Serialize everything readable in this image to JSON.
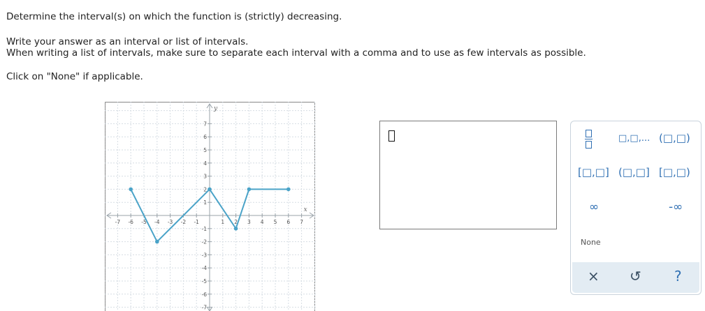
{
  "question": {
    "line1": "Determine the interval(s) on which the function is (strictly) decreasing.",
    "line2": "Write your answer as an interval or list of intervals.",
    "line3": "When writing a list of intervals, make sure to separate each interval with a comma and to use as few intervals as possible.",
    "line4": "Click on \"None\" if applicable."
  },
  "graph": {
    "xlabel": "x",
    "ylabel": "y",
    "xlim": [
      -7,
      7
    ],
    "ylim": [
      -7,
      7
    ],
    "x_ticks": [
      "-7",
      "-6",
      "-5",
      "-4",
      "-3",
      "-2",
      "-1",
      "1",
      "2",
      "3",
      "4",
      "5",
      "6",
      "7"
    ],
    "y_ticks": [
      "7",
      "6",
      "5",
      "4",
      "3",
      "2",
      "1",
      "-1",
      "-2",
      "-3",
      "-4",
      "-5",
      "-6",
      "-7"
    ],
    "grid": true,
    "line_color": "#4aa3c8",
    "points": [
      [
        -6,
        2
      ],
      [
        -4,
        -2
      ],
      [
        0,
        2
      ],
      [
        2,
        -1
      ],
      [
        3,
        2
      ],
      [
        6,
        2
      ]
    ]
  },
  "palette": {
    "fraction_label": "",
    "list_label": "□,□,...",
    "open_open": "(□,□)",
    "closed_closed": "[□,□]",
    "open_closed": "(□,□]",
    "closed_open": "[□,□)",
    "infinity": "∞",
    "neg_infinity": "-∞",
    "none": "None",
    "clear": "×",
    "undo": "↺",
    "help": "?"
  }
}
